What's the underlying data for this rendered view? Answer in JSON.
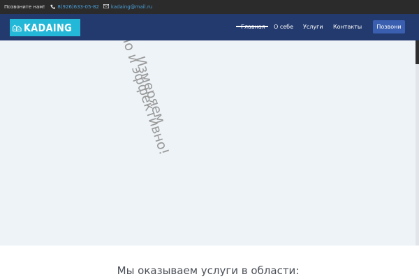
{
  "topbar": {
    "call_label": "Позвоните нам!",
    "phone_icon": "phone-icon",
    "phone": "8(926)633-05-82",
    "email_icon": "mail-icon",
    "email": "kadaing@mail.ru"
  },
  "navbar": {
    "logo_text": "KADAING",
    "items": [
      {
        "label": "Главная",
        "active": true
      },
      {
        "label": "О себе"
      },
      {
        "label": "Услуги"
      },
      {
        "label": "Контакты"
      }
    ],
    "call_button": "Позвони"
  },
  "hero": {
    "line1": "Измеряем",
    "line2": "но и эффективно!"
  },
  "services": {
    "heading": "Мы оказываем услуги в области:"
  },
  "colors": {
    "topbar_bg": "#2b2b2b",
    "navbar_bg": "#233a6e",
    "logo_bg": "#24b8d8",
    "accent_link": "#4a9fd8",
    "call_button_bg": "#3b5fb0",
    "hero_bg": "#eef3f7"
  }
}
